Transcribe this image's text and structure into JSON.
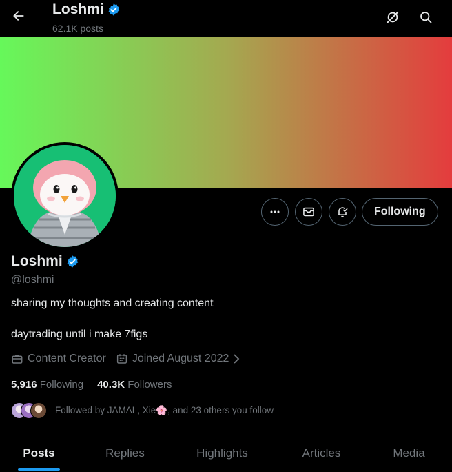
{
  "header": {
    "display_name": "Loshmi",
    "posts_count": "62.1K posts"
  },
  "profile": {
    "display_name": "Loshmi",
    "handle": "@loshmi",
    "bio_line1": "sharing my thoughts and creating content",
    "bio_line2": "daytrading until i make 7figs",
    "category": "Content Creator",
    "joined": "Joined August 2022",
    "following_count": "5,916",
    "following_label": "Following",
    "followers_count": "40.3K",
    "followers_label": "Followers",
    "followed_by": "Followed by JAMAL, Xie",
    "followed_by_emoji": "🌸",
    "followed_by_rest": ", and 23 others you follow",
    "follow_button": "Following"
  },
  "tabs": [
    "Posts",
    "Replies",
    "Highlights",
    "Articles",
    "Media"
  ],
  "active_tab": "Posts",
  "colors": {
    "accent": "#1d9bf0",
    "banner_start": "#66f85a",
    "banner_end": "#e43c3d",
    "avatar_bg": "#17bf74"
  }
}
